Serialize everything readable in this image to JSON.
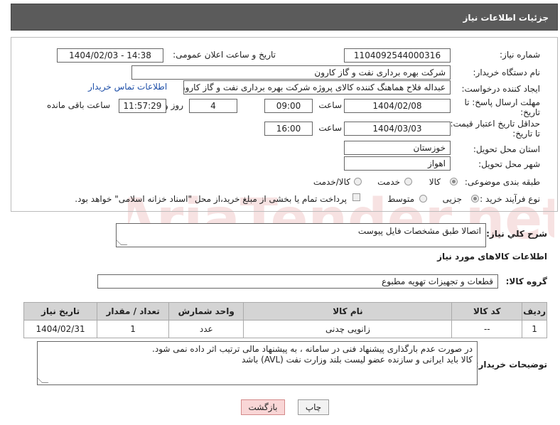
{
  "header": {
    "title": "جزئیات اطلاعات نیاز"
  },
  "form": {
    "need_number_label": "شماره نیاز:",
    "need_number": "1104092544000316",
    "announce_label": "تاریخ و ساعت اعلان عمومی:",
    "announce_value": "1404/02/03 - 14:38",
    "buyer_org_label": "نام دستگاه خریدار:",
    "buyer_org": "شرکت بهره برداری نفت و گاز کارون",
    "creator_label": "ایجاد کننده درخواست:",
    "creator": "عبداله فلاح هماهنگ کننده کالای پروژه شرکت بهره برداری نفت و گاز کارون",
    "contact_link": "اطلاعات تماس خریدار",
    "reply_deadline_label_1": "مهلت ارسال پاسخ: تا",
    "reply_deadline_label_2": "تاریخ:",
    "reply_date": "1404/02/08",
    "time_label": "ساعت",
    "reply_time": "09:00",
    "days": "4",
    "days_label": "روز و",
    "remaining_time": "11:57:29",
    "remaining_label": "ساعت باقی مانده",
    "price_validity_label_1": "حداقل تاریخ اعتبار قیمت:",
    "price_validity_label_2": "تا تاریخ:",
    "price_date": "1404/03/03",
    "price_time": "16:00",
    "province_label": "استان محل تحویل:",
    "province": "خوزستان",
    "city_label": "شهر محل تحویل:",
    "city": "اهواز",
    "category_label": "طبقه بندی موضوعی:",
    "category_options": [
      "کالا",
      "خدمت",
      "کالا/خدمت"
    ],
    "process_label": "نوع فرآیند خرید :",
    "process_options": [
      "جزیی",
      "متوسط"
    ],
    "payment_note": "پرداخت تمام یا بخشی از مبلغ خرید،از محل \"اسناد خزانه اسلامی\" خواهد بود."
  },
  "description": {
    "label": "شرح کلي نياز:",
    "value": "اتصالا طبق مشخصات فایل پیوست"
  },
  "goods": {
    "section_title": "اطلاعات کالاهای مورد نیاز",
    "group_label": "گروه کالا:",
    "group_value": "قطعات و تجهیزات تهویه مطبوع",
    "columns": [
      "ردیف",
      "کد کالا",
      "نام کالا",
      "واحد شمارش",
      "تعداد / مقدار",
      "تاریخ نیاز"
    ],
    "rows": [
      [
        "1",
        "--",
        "زانویی چدنی",
        "عدد",
        "1",
        "1404/02/31"
      ]
    ]
  },
  "buyer_notes": {
    "label": "توضیحات خریدار:",
    "line1": "در صورت عدم بارگذاری پیشنهاد فنی در سامانه ، به پیشنهاد مالی ترتیب اثر داده نمی شود.",
    "line2": "کالا باید ایرانی و سازنده عضو لیست بلند وزارت نفت (AVL) باشد"
  },
  "buttons": {
    "print": "چاپ",
    "back": "بازگشت"
  },
  "watermark": {
    "text": "AriaTender.net"
  },
  "colors": {
    "header_bg": "#5b5b5b",
    "link": "#1e4fa8",
    "back_btn_bg": "#f9d6d6",
    "table_head": "#d4d4d4"
  }
}
